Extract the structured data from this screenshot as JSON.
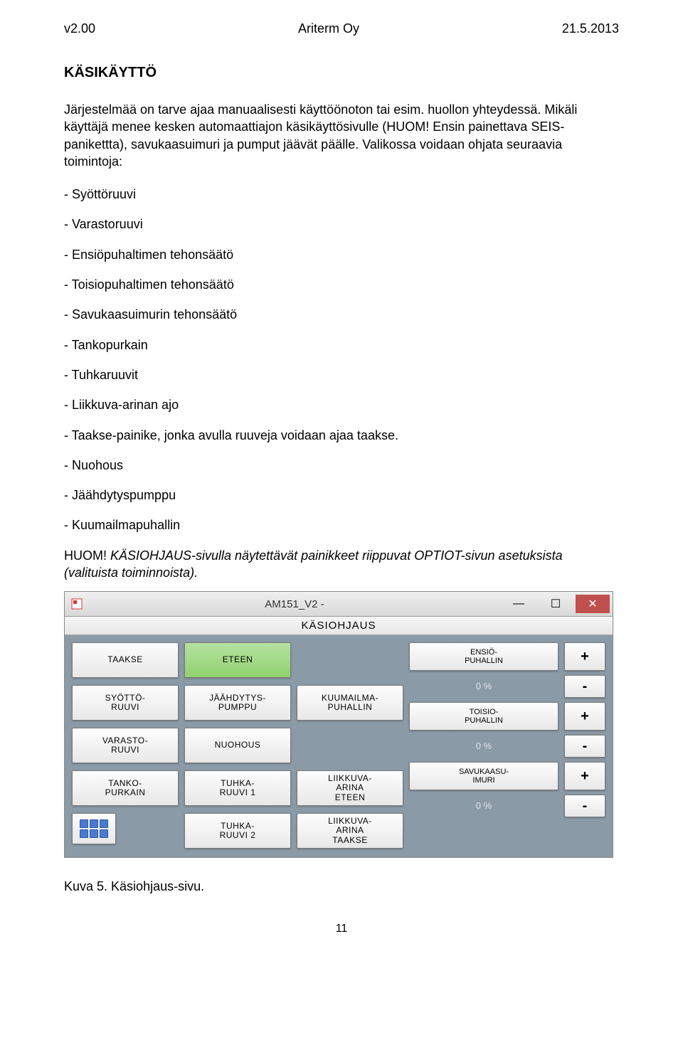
{
  "header": {
    "left": "v2.00",
    "center": "Ariterm Oy",
    "right": "21.5.2013"
  },
  "section_title": "KÄSIKÄYTTÖ",
  "para1": "Järjestelmää on tarve ajaa manuaalisesti käyttöönoton tai esim. huollon yhteydessä. Mikäli käyttäjä menee kesken automaattiajon käsikäyttösivulle (HUOM! Ensin painettava SEIS-panikettta), savukaasuimuri ja pumput jäävät päälle. Valikossa voidaan ohjata seuraavia toimintoja:",
  "list": [
    "- Syöttöruuvi",
    "- Varastoruuvi",
    "- Ensiöpuhaltimen tehonsäätö",
    "- Toisiopuhaltimen tehonsäätö",
    "- Savukaasuimurin tehonsäätö",
    "- Tankopurkain",
    "- Tuhkaruuvit",
    "- Liikkuva-arinan ajo",
    "- Taakse-painike, jonka avulla ruuveja voidaan ajaa taakse.",
    "- Nuohous",
    "- Jäähdytyspumppu",
    "- Kuumailmapuhallin"
  ],
  "note_lead": "HUOM! ",
  "note_rest": "KÄSIOHJAUS-sivulla näytettävät painikkeet riippuvat OPTIOT-sivun asetuksista (valituista toiminnoista).",
  "screenshot": {
    "title": "AM151_V2 -",
    "subtitle": "KÄSIOHJAUS",
    "col1": {
      "taakse": "TAAKSE",
      "syotto": "SYÖTTÖ-\nRUUVI",
      "varasto": "VARASTO-\nRUUVI",
      "tanko": "TANKO-\nPURKAIN"
    },
    "col2": {
      "eteen": "ETEEN",
      "jaahdytys": "JÄÄHDYTYS-\nPUMPPU",
      "nuohous": "NUOHOUS",
      "tuhka1": "TUHKA-\nRUUVI 1",
      "tuhka2": "TUHKA-\nRUUVI 2"
    },
    "col3": {
      "kuumailma": "KUUMAILMA-\nPUHALLIN",
      "liikkuva_eteen": "LIIKKUVA-\nARINA\nETEEN",
      "liikkuva_taakse": "LIIKKUVA-\nARINA\nTAAKSE"
    },
    "right": {
      "ensio": {
        "label": "ENSIÖ-\nPUHALLIN",
        "value": "0 %"
      },
      "toisio": {
        "label": "TOISIO-\nPUHALLIN",
        "value": "0 %"
      },
      "savu": {
        "label": "SAVUKAASU-\nIMURI",
        "value": "0 %"
      }
    }
  },
  "caption": "Kuva 5. Käsiohjaus-sivu.",
  "page_number": "11"
}
